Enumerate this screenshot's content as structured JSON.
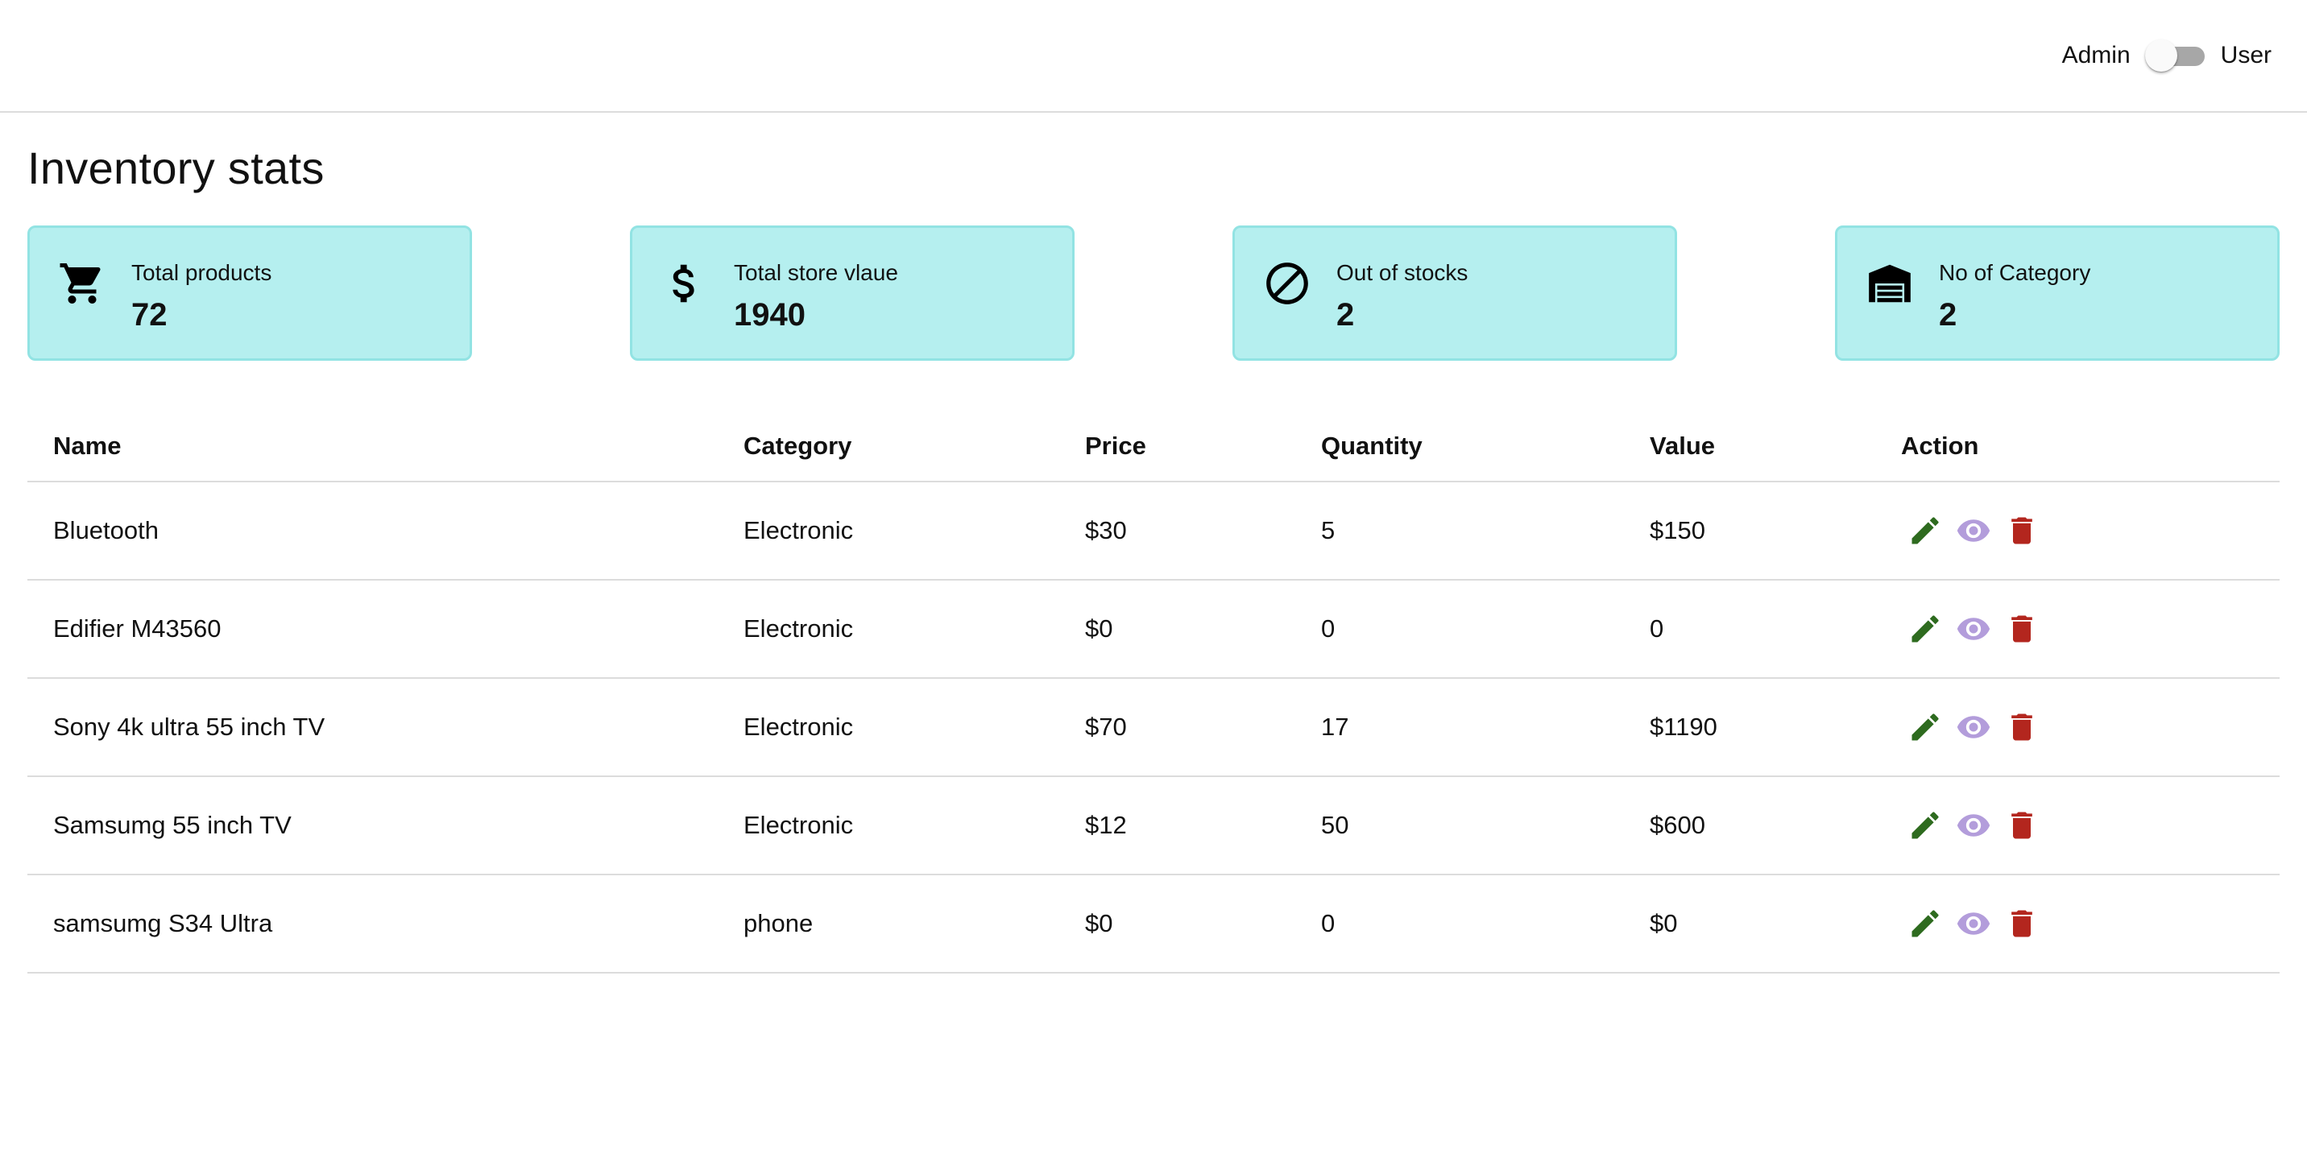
{
  "topbar": {
    "left_label": "Admin",
    "right_label": "User",
    "toggle_state": "admin"
  },
  "page": {
    "title": "Inventory stats"
  },
  "stats": [
    {
      "icon": "cart-icon",
      "label": "Total products",
      "value": "72"
    },
    {
      "icon": "dollar-icon",
      "label": "Total store vlaue",
      "value": "1940"
    },
    {
      "icon": "block-icon",
      "label": "Out of stocks",
      "value": "2"
    },
    {
      "icon": "warehouse-icon",
      "label": "No of Category",
      "value": "2"
    }
  ],
  "table": {
    "headers": [
      "Name",
      "Category",
      "Price",
      "Quantity",
      "Value",
      "Action"
    ],
    "rows": [
      {
        "name": "Bluetooth",
        "category": "Electronic",
        "price": "$30",
        "quantity": "5",
        "value": "$150"
      },
      {
        "name": "Edifier M43560",
        "category": "Electronic",
        "price": "$0",
        "quantity": "0",
        "value": "0"
      },
      {
        "name": "Sony 4k ultra 55 inch TV",
        "category": "Electronic",
        "price": "$70",
        "quantity": "17",
        "value": "$1190"
      },
      {
        "name": "Samsumg 55 inch TV",
        "category": "Electronic",
        "price": "$12",
        "quantity": "50",
        "value": "$600"
      },
      {
        "name": "samsumg S34 Ultra",
        "category": "phone",
        "price": "$0",
        "quantity": "0",
        "value": "$0"
      }
    ],
    "action_icons": [
      "edit-icon",
      "view-icon",
      "delete-icon"
    ]
  },
  "colors": {
    "card_bg": "#b5efef",
    "card_border": "#92e3e3",
    "edit": "#2e6b1f",
    "view": "#b39ddb",
    "delete": "#b3261e"
  }
}
